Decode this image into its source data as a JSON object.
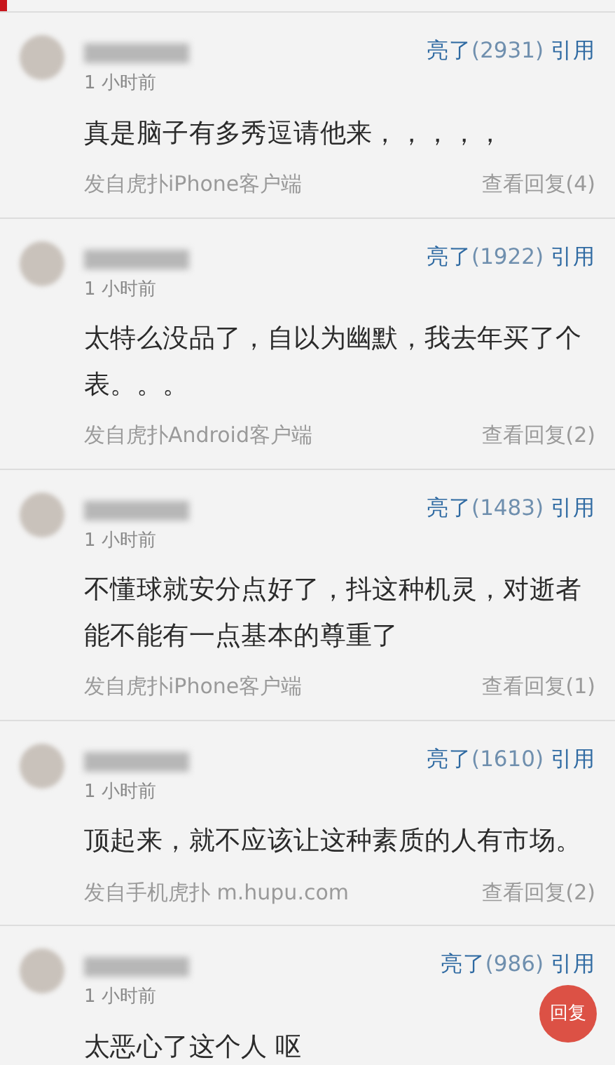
{
  "comments": [
    {
      "time": "1 小时前",
      "like": "亮了",
      "count": "(2931)",
      "quote": "引用",
      "text": "真是脑子有多秀逗请他来，，，，，",
      "source": "发自虎扑iPhone客户端",
      "replies": "查看回复(4)"
    },
    {
      "time": "1 小时前",
      "like": "亮了",
      "count": "(1922)",
      "quote": "引用",
      "text": "太特么没品了，自以为幽默，我去年买了个表。。。",
      "source": "发自虎扑Android客户端",
      "replies": "查看回复(2)"
    },
    {
      "time": "1 小时前",
      "like": "亮了",
      "count": "(1483)",
      "quote": "引用",
      "text": "不懂球就安分点好了，抖这种机灵，对逝者能不能有一点基本的尊重了",
      "source": "发自虎扑iPhone客户端",
      "replies": "查看回复(1)"
    },
    {
      "time": "1 小时前",
      "like": "亮了",
      "count": "(1610)",
      "quote": "引用",
      "text": "顶起来，就不应该让这种素质的人有市场。",
      "source": "发自手机虎扑 m.hupu.com",
      "replies": "查看回复(2)"
    },
    {
      "time": "1 小时前",
      "like": "亮了",
      "count": "(986)",
      "quote": "引用",
      "text": "太恶心了这个人 呕"
    }
  ],
  "reply_button": "回复"
}
